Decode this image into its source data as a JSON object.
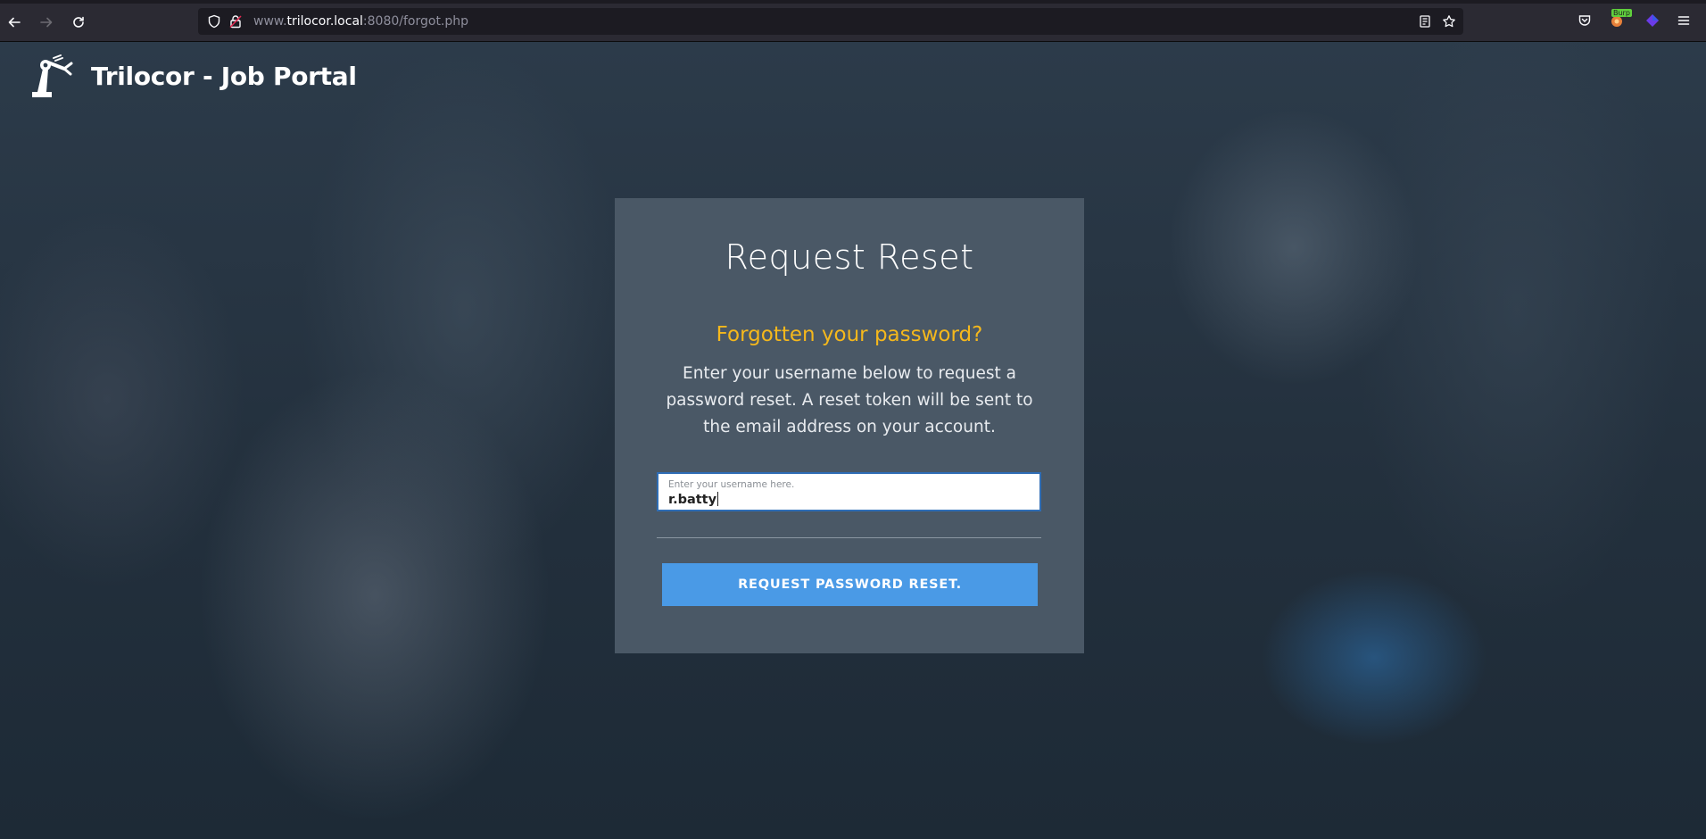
{
  "browser": {
    "url_prefix": "www.",
    "url_host": "trilocor.local",
    "url_rest": ":8080/forgot.php",
    "burp_badge": "Burp"
  },
  "site": {
    "brand_name": "Trilocor - Job Portal"
  },
  "reset_form": {
    "title": "Request Reset",
    "subtitle": "Forgotten your password?",
    "description": "Enter your username below to request a password reset. A reset token will be sent to the email address on your account.",
    "username_label": "Enter your username here.",
    "username_value": "r.batty",
    "submit_label": "REQUEST PASSWORD RESET."
  },
  "colors": {
    "accent_yellow": "#f5b81c",
    "button_blue": "#4a9ae6",
    "card_bg": "#4a5866"
  }
}
